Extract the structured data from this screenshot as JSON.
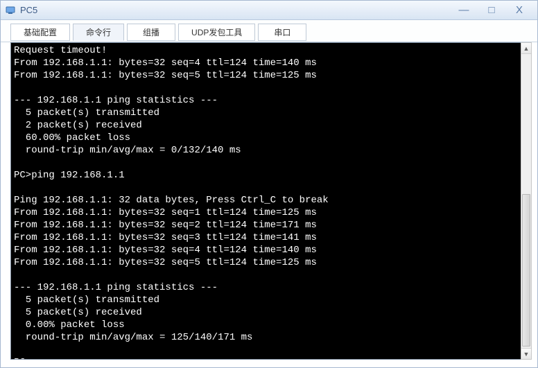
{
  "window": {
    "title": "PC5",
    "minimize": "—",
    "maximize": "□",
    "close": "X"
  },
  "tabs": [
    {
      "label": "基础配置"
    },
    {
      "label": "命令行"
    },
    {
      "label": "组播"
    },
    {
      "label": "UDP发包工具"
    },
    {
      "label": "串口"
    }
  ],
  "terminal_lines": [
    "Request timeout!",
    "From 192.168.1.1: bytes=32 seq=4 ttl=124 time=140 ms",
    "From 192.168.1.1: bytes=32 seq=5 ttl=124 time=125 ms",
    "",
    "--- 192.168.1.1 ping statistics ---",
    "  5 packet(s) transmitted",
    "  2 packet(s) received",
    "  60.00% packet loss",
    "  round-trip min/avg/max = 0/132/140 ms",
    "",
    "PC>ping 192.168.1.1",
    "",
    "Ping 192.168.1.1: 32 data bytes, Press Ctrl_C to break",
    "From 192.168.1.1: bytes=32 seq=1 ttl=124 time=125 ms",
    "From 192.168.1.1: bytes=32 seq=2 ttl=124 time=171 ms",
    "From 192.168.1.1: bytes=32 seq=3 ttl=124 time=141 ms",
    "From 192.168.1.1: bytes=32 seq=4 ttl=124 time=140 ms",
    "From 192.168.1.1: bytes=32 seq=5 ttl=124 time=125 ms",
    "",
    "--- 192.168.1.1 ping statistics ---",
    "  5 packet(s) transmitted",
    "  5 packet(s) received",
    "  0.00% packet loss",
    "  round-trip min/avg/max = 125/140/171 ms",
    "",
    "PC>"
  ],
  "scrollbar": {
    "up": "▲",
    "down": "▼"
  }
}
